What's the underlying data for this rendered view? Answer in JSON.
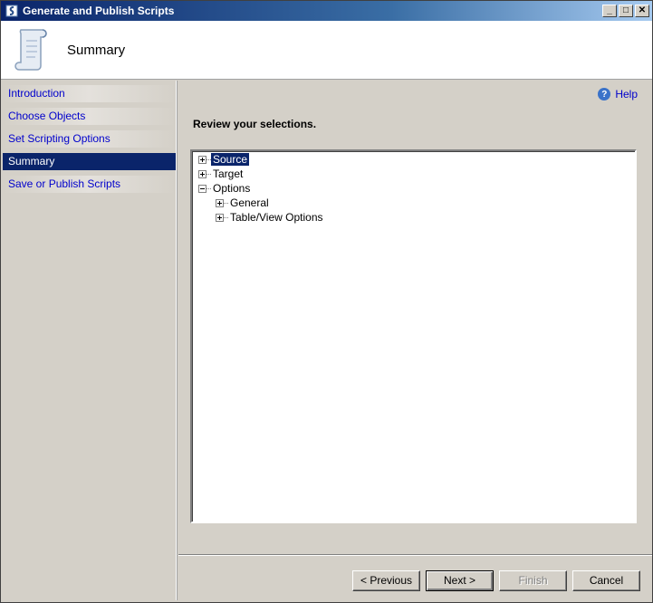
{
  "window": {
    "title": "Generate and Publish Scripts",
    "controls": {
      "minimize": "_",
      "maximize": "□",
      "close": "✕"
    }
  },
  "header": {
    "title": "Summary",
    "icon": "script-scroll-icon"
  },
  "sidebar": {
    "items": [
      {
        "label": "Introduction",
        "active": false
      },
      {
        "label": "Choose Objects",
        "active": false
      },
      {
        "label": "Set Scripting Options",
        "active": false
      },
      {
        "label": "Summary",
        "active": true
      },
      {
        "label": "Save or Publish Scripts",
        "active": false
      }
    ]
  },
  "main": {
    "help_label": "Help",
    "help_icon_glyph": "?",
    "review_label": "Review your selections.",
    "tree": [
      {
        "label": "Source",
        "expanded": false,
        "selected": true,
        "level": 0
      },
      {
        "label": "Target",
        "expanded": false,
        "selected": false,
        "level": 0
      },
      {
        "label": "Options",
        "expanded": true,
        "selected": false,
        "level": 0
      },
      {
        "label": "General",
        "expanded": false,
        "selected": false,
        "level": 1
      },
      {
        "label": "Table/View Options",
        "expanded": false,
        "selected": false,
        "level": 1
      }
    ]
  },
  "buttons": {
    "previous": "< Previous",
    "next": "Next >",
    "finish": "Finish",
    "cancel": "Cancel"
  },
  "colors": {
    "selection": "#0a246a",
    "link": "#0000cc",
    "face": "#d4d0c8"
  }
}
